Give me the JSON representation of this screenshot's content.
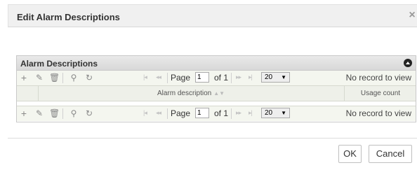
{
  "dialog": {
    "title": "Edit Alarm Descriptions",
    "close_glyph": "×",
    "ok_label": "OK",
    "cancel_label": "Cancel"
  },
  "grid": {
    "caption": "Alarm Descriptions",
    "columns": [
      "Alarm description",
      "Usage count"
    ],
    "rows": [],
    "pager": {
      "page_label": "Page",
      "current_page": "1",
      "of_label": "of 1",
      "rows_per_page": "20",
      "no_records": "No record to view"
    },
    "toolbar_icons": [
      "add-icon",
      "edit-icon",
      "delete-icon",
      "search-icon",
      "refresh-icon"
    ]
  }
}
